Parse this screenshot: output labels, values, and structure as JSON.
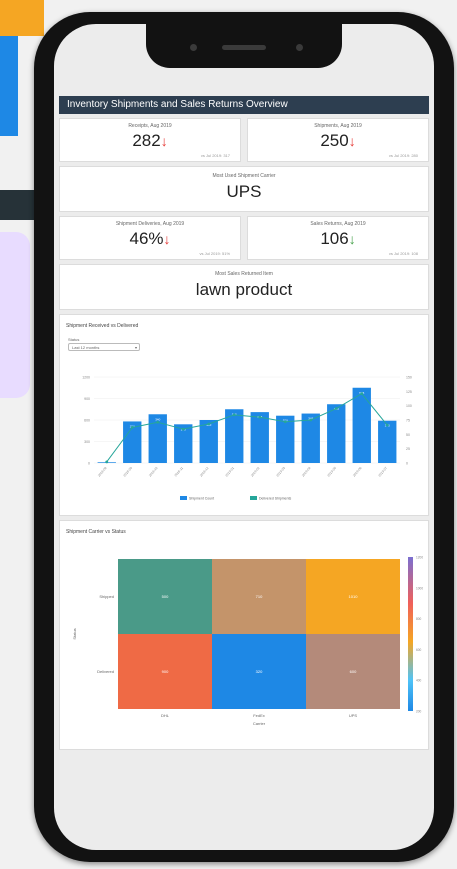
{
  "dashboard": {
    "title": "Inventory Shipments and Sales Returns Overview",
    "kpis_row1": [
      {
        "label": "Receipts, Aug 2019",
        "value": "282",
        "arrow": "↓",
        "sub": "vs Jul 2019: 317"
      },
      {
        "label": "Shipments, Aug 2019",
        "value": "250",
        "arrow": "↓",
        "sub": "vs Jul 2019: 280"
      }
    ],
    "carrier": {
      "label": "Most Used Shipment Carrier",
      "value": "UPS"
    },
    "kpis_row2": [
      {
        "label": "Shipment Deliveries, Aug 2019",
        "value": "46%",
        "arrow": "↓",
        "sub": "vs Jul 2019: 51%"
      },
      {
        "label": "Sales Returns, Aug 2019",
        "value": "106",
        "arrow": "↓",
        "sub": "vs Jul 2019: 108"
      }
    ],
    "return_item": {
      "label": "Most Sales Returned Item",
      "value": "lawn product"
    }
  },
  "chart_data": [
    {
      "type": "bar",
      "title": "Shipment Received vs Delivered",
      "filter": {
        "label": "Status",
        "value": "Last 12 months"
      },
      "categories": [
        "2018-08",
        "2018-09",
        "2018-10",
        "2018-11",
        "2018-12",
        "2019-01",
        "2019-02",
        "2019-03",
        "2019-04",
        "2019-05",
        "2019-06",
        "2019-07"
      ],
      "series": [
        {
          "name": "Shipment Count",
          "values": [
            5,
            290,
            340,
            270,
            300,
            375,
            355,
            330,
            345,
            410,
            525,
            295
          ]
        },
        {
          "name": "Delivered Shipments",
          "values": [
            2,
            62,
            71,
            59,
            68,
            84,
            80,
            72,
            75,
            95,
            121,
            66
          ]
        }
      ],
      "data_labels": [
        "",
        "290",
        "340",
        "270",
        "300",
        "375",
        "355",
        "330",
        "345",
        "410",
        "525",
        "295"
      ],
      "left_ticks": [
        "1200",
        "900",
        "600",
        "300",
        "0"
      ],
      "right_ticks": [
        "150",
        "125",
        "100",
        "75",
        "50",
        "25",
        "0"
      ],
      "ylim": [
        0,
        600
      ],
      "y2lim": [
        0,
        150
      ],
      "colors": {
        "bars": "#1e88e5",
        "line": "#26a69a"
      },
      "legend_position": "bottom"
    },
    {
      "type": "heatmap",
      "title": "Shipment Carrier vs Status",
      "xlabel": "Carrier",
      "ylabel": "Status",
      "x_categories": [
        "DHL",
        "FedEx",
        "UPS"
      ],
      "y_categories": [
        "Shipped",
        "Delivered"
      ],
      "cells": [
        {
          "status": "Shipped",
          "carrier": "DHL",
          "value": "500",
          "color": "#4a9a88"
        },
        {
          "status": "Shipped",
          "carrier": "FedEx",
          "value": "710",
          "color": "#c4946a"
        },
        {
          "status": "Shipped",
          "carrier": "UPS",
          "value": "1010",
          "color": "#f5a623"
        },
        {
          "status": "Delivered",
          "carrier": "DHL",
          "value": "900",
          "color": "#ef6a45"
        },
        {
          "status": "Delivered",
          "carrier": "FedEx",
          "value": "320",
          "color": "#1e88e5"
        },
        {
          "status": "Delivered",
          "carrier": "UPS",
          "value": "600",
          "color": "#b48a7a"
        }
      ],
      "scale_ticks": [
        "1200",
        "1000",
        "800",
        "600",
        "400",
        "200"
      ]
    }
  ]
}
